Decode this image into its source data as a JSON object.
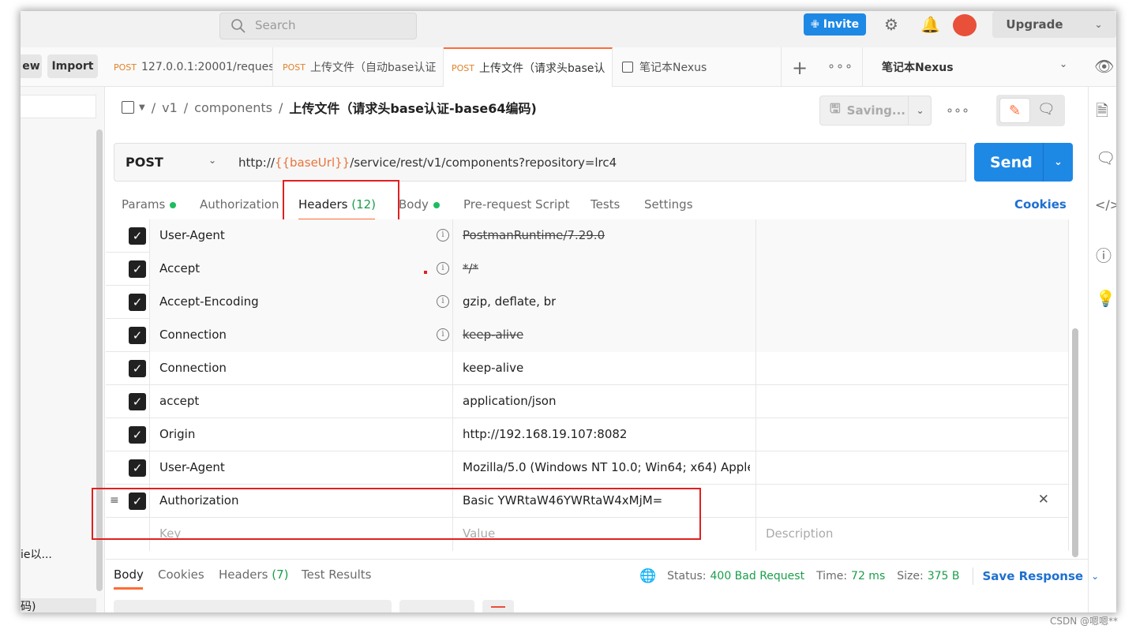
{
  "topbar": {
    "search_placeholder": "Search",
    "invite_label": "Invite",
    "upgrade_label": "Upgrade"
  },
  "workspace": {
    "new_label": "ew",
    "import_label": "Import"
  },
  "tabs": [
    {
      "method": "POST",
      "label": "127.0.0.1:20001/request/"
    },
    {
      "method": "POST",
      "label": "上传文件（自动base认证"
    },
    {
      "method": "POST",
      "label": "上传文件（请求头base认"
    },
    {
      "method": "",
      "label": "笔记本Nexus"
    }
  ],
  "environment": {
    "name": "笔记本Nexus"
  },
  "sidebar": {
    "item_a": "ie以...",
    "item_b": "码)"
  },
  "breadcrumb": {
    "sep": "/",
    "part1": "v1",
    "part2": "components",
    "current": "上传文件（请求头base认证-base64编码)"
  },
  "toolbar": {
    "saving_label": "Saving..."
  },
  "request": {
    "method": "POST",
    "url_prefix": "http://",
    "url_var": "{{baseUrl}}",
    "url_suffix": "/service/rest/v1/components?repository=lrc4",
    "send_label": "Send"
  },
  "request_tabs": {
    "params": "Params",
    "authorization": "Authorization",
    "headers": "Headers",
    "headers_count": "(12)",
    "body": "Body",
    "prerequest": "Pre-request Script",
    "tests": "Tests",
    "settings": "Settings",
    "cookies": "Cookies"
  },
  "headers_table": {
    "rows": [
      {
        "key": "User-Agent",
        "value": "PostmanRuntime/7.29.0",
        "auto": true,
        "struck": true
      },
      {
        "key": "Accept",
        "value": "*/*",
        "auto": true,
        "struck": true
      },
      {
        "key": "Accept-Encoding",
        "value": "gzip, deflate, br",
        "auto": true,
        "struck": false
      },
      {
        "key": "Connection",
        "value": "keep-alive",
        "auto": true,
        "struck": true
      },
      {
        "key": "Connection",
        "value": "keep-alive",
        "auto": false,
        "struck": false
      },
      {
        "key": "accept",
        "value": "application/json",
        "auto": false,
        "struck": false
      },
      {
        "key": "Origin",
        "value": "http://192.168.19.107:8082",
        "auto": false,
        "struck": false
      },
      {
        "key": "User-Agent",
        "value": "Mozilla/5.0 (Windows NT 10.0; Win64; x64) Apple...",
        "auto": false,
        "struck": false
      },
      {
        "key": "Authorization",
        "value": "Basic YWRtaW46YWRtaW4xMjM=",
        "auto": false,
        "struck": false
      }
    ],
    "placeholder_key": "Key",
    "placeholder_value": "Value",
    "placeholder_description": "Description"
  },
  "response": {
    "tabs": {
      "body": "Body",
      "cookies": "Cookies",
      "headers": "Headers",
      "headers_count": "(7)",
      "test_results": "Test Results"
    },
    "status_label": "Status:",
    "status_value": "400 Bad Request",
    "time_label": "Time:",
    "time_value": "72 ms",
    "size_label": "Size:",
    "size_value": "375 B",
    "save_label": "Save Response"
  },
  "watermark": "CSDN @嗯嗯**",
  "colors": {
    "accent": "#ff6c37",
    "primary": "#1e88e5",
    "success": "#1a9e4b",
    "highlight_border": "#e02020"
  }
}
